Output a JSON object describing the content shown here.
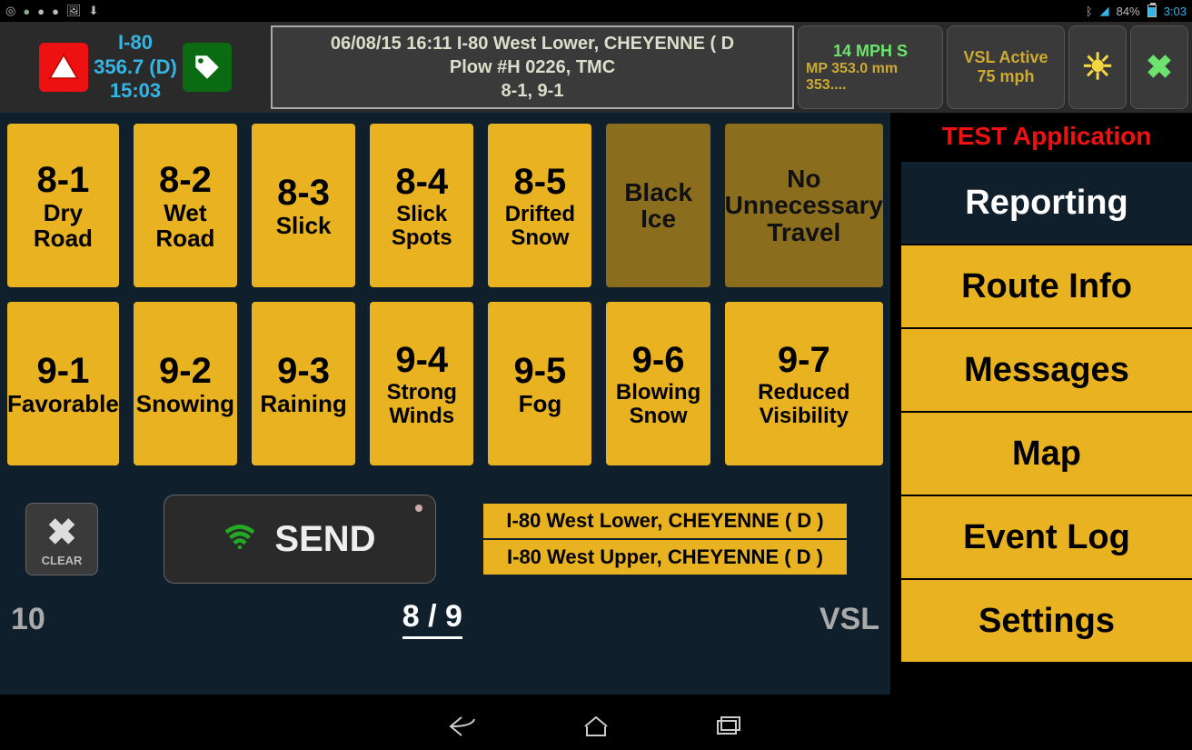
{
  "statusbar": {
    "battery": "84%",
    "clock": "3:03"
  },
  "header": {
    "location": {
      "route": "I-80",
      "milepost": "356.7 (D)",
      "time": "15:03"
    },
    "message": {
      "line1": "06/08/15 16:11 I-80 West Lower, CHEYENNE ( D",
      "line2": "Plow #H 0226, TMC",
      "line3": "8-1, 9-1"
    },
    "speed": {
      "top": "14 MPH S",
      "bottom": "MP 353.0 mm 353...."
    },
    "vsl": {
      "top": "VSL Active",
      "bottom": "75 mph"
    }
  },
  "tiles_row1": [
    {
      "code": "8-1",
      "label": "Dry Road",
      "dim": false
    },
    {
      "code": "8-2",
      "label": "Wet Road",
      "dim": false
    },
    {
      "code": "8-3",
      "label": "Slick",
      "dim": false
    },
    {
      "code": "8-4",
      "label": "Slick Spots",
      "dim": false
    },
    {
      "code": "8-5",
      "label": "Drifted Snow",
      "dim": false
    },
    {
      "code": "",
      "label": "Black Ice",
      "dim": true
    },
    {
      "code": "",
      "label": "No Unnecessary Travel",
      "dim": true
    }
  ],
  "tiles_row2": [
    {
      "code": "9-1",
      "label": "Favorable",
      "dim": false
    },
    {
      "code": "9-2",
      "label": "Snowing",
      "dim": false
    },
    {
      "code": "9-3",
      "label": "Raining",
      "dim": false
    },
    {
      "code": "9-4",
      "label": "Strong Winds",
      "dim": false
    },
    {
      "code": "9-5",
      "label": "Fog",
      "dim": false
    },
    {
      "code": "9-6",
      "label": "Blowing Snow",
      "dim": false
    },
    {
      "code": "9-7",
      "label": "Reduced Visibility",
      "dim": false
    }
  ],
  "controls": {
    "clear": "CLEAR",
    "send": "SEND",
    "routes": [
      "I-80 West Lower, CHEYENNE ( D )",
      "I-80 West Upper, CHEYENNE ( D )"
    ]
  },
  "sidebar": {
    "banner": "TEST Application",
    "items": [
      {
        "label": "Reporting",
        "active": true
      },
      {
        "label": "Route Info",
        "active": false
      },
      {
        "label": "Messages",
        "active": false
      },
      {
        "label": "Map",
        "active": false
      },
      {
        "label": "Event Log",
        "active": false
      },
      {
        "label": "Settings",
        "active": false
      }
    ]
  },
  "footer": {
    "left": "10",
    "center": "8 / 9",
    "right": "VSL"
  }
}
